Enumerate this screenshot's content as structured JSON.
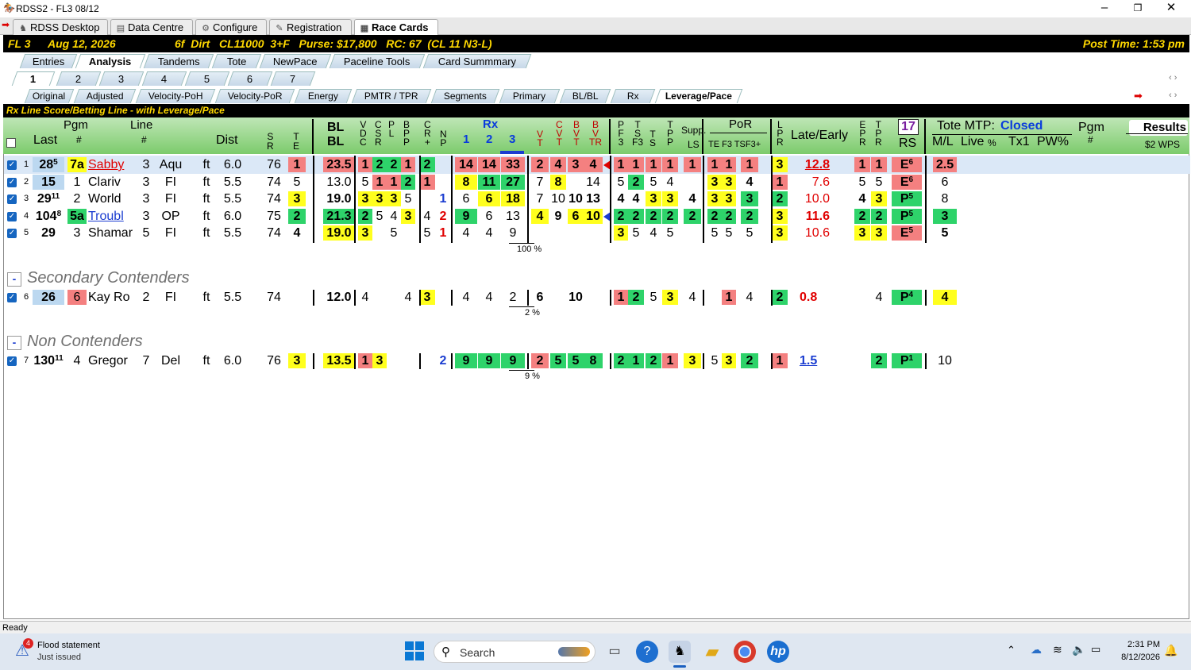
{
  "window": {
    "title": "RDSS2 - FL3  08/12"
  },
  "main_tabs": [
    {
      "label": "RDSS Desktop",
      "icon": "horse-icon"
    },
    {
      "label": "Data Centre",
      "icon": "database-icon"
    },
    {
      "label": "Configure",
      "icon": "gear-icon"
    },
    {
      "label": "Registration",
      "icon": "registration-icon"
    },
    {
      "label": "Race Cards",
      "icon": "document-icon"
    }
  ],
  "race_header": {
    "track_race": "FL  3",
    "date": "Aug 12, 2026",
    "conditions": "6f  Dirt   CL11000  3+F   Purse: $17,800   RC: 67  (CL 11 N3-L)",
    "post_time": "Post Time: 1:53 pm"
  },
  "view_tabs": [
    "Entries",
    "Analysis",
    "Tandems",
    "Tote",
    "NewPace",
    "Paceline Tools",
    "Card Summmary"
  ],
  "race_tabs": [
    "1",
    "2",
    "3",
    "4",
    "5",
    "6",
    "7"
  ],
  "analysis_tabs": [
    "Original",
    "Adjusted",
    "Velocity-PoH",
    "Velocity-PoR",
    "Energy",
    "PMTR / TPR",
    "Segments",
    "Primary",
    "BL/BL",
    "Rx",
    "Leverage/Pace"
  ],
  "rx_line_title": "Rx Line Score/Betting Line - with Leverage/Pace",
  "columns": {
    "last": "Last",
    "pgm": "Pgm",
    "pgm_hash": "#",
    "line": "Line",
    "line_hash": "#",
    "dist": "Dist",
    "sr": "S\nR",
    "te": "T\nE",
    "bl_top": "BL",
    "bl_bot": "BL",
    "vdc": "V\nD\nC",
    "csr": "C\nS\nR",
    "pl": "P\nL",
    "bpp": "B\nP\nP",
    "cr": "C\nR\n+",
    "np": "N\nP",
    "rx": "Rx",
    "rx1": "1",
    "rx2": "2",
    "rx3": "3",
    "vt": "V\nT",
    "cvt": "C\nV\nT",
    "bvt": "B\nV\nT",
    "bvtr": "B\nV\nTR",
    "pf3": "P\nF\n3",
    "stf3": "T\nS\nF3",
    "ts": "T\nS",
    "tpp": "T\nP\nP",
    "supp": "Supp.",
    "supp_ls": "LS",
    "por": "PoR",
    "por_sub": "TE F3 TSF3+",
    "lpr": "L\nP\nR",
    "late_early": "Late/Early",
    "epr": "E\nP\nR",
    "tpr": "T\nP\nR",
    "rs_num": "17",
    "rs": "RS",
    "tote_mtp": "Tote MTP:",
    "tote_status": "Closed",
    "ml": "M/L",
    "live": "Live",
    "pct": "%",
    "tx1": "Tx1",
    "pw": "PW%",
    "pgm2": "Pgm",
    "results": "Results",
    "wps": "$2 WPS"
  },
  "rows": [
    {
      "n": "1",
      "last": "28",
      "last_sup": "5",
      "pgm": "7a",
      "name": "Sabby",
      "line": "3",
      "trk": "Aqu",
      "surf": "ft",
      "dist": "6.0",
      "sr": "76",
      "te": "1",
      "bl": "23.5",
      "vdc": "1",
      "csr": "2",
      "pl": "2",
      "bpp": "1",
      "cr": "2",
      "np": "",
      "rx1": "14",
      "rx2": "14",
      "rx3": "33",
      "vt": "2",
      "cvt": "4",
      "bvt": "3",
      "bvtr": "4",
      "pf3": "1",
      "stf3": "1",
      "ts": "1",
      "tpp": "1",
      "ls": "1",
      "te2": "1",
      "f3": "1",
      "tsf3": "1",
      "lpr": "3",
      "le": "12.8",
      "epr": "1",
      "tpr": "1",
      "rs": "E",
      "rs_sup": "6",
      "ml": "2.5"
    },
    {
      "n": "2",
      "last": "15",
      "last_sup": "",
      "pgm": "1",
      "name": "Clariv",
      "line": "3",
      "trk": "FI",
      "surf": "ft",
      "dist": "5.5",
      "sr": "74",
      "te": "5",
      "bl": "13.0",
      "vdc": "5",
      "csr": "1",
      "pl": "1",
      "bpp": "2",
      "cr": "1",
      "np": "",
      "rx1": "8",
      "rx2": "11",
      "rx3": "27",
      "vt": "7",
      "cvt": "8",
      "bvt": "",
      "bvtr": "14",
      "pf3": "5",
      "stf3": "2",
      "ts": "5",
      "tpp": "4",
      "ls": "",
      "te2": "3",
      "f3": "3",
      "tsf3": "4",
      "lpr": "1",
      "le": "7.6",
      "epr": "5",
      "tpr": "5",
      "rs": "E",
      "rs_sup": "6",
      "ml": "6"
    },
    {
      "n": "3",
      "last": "29",
      "last_sup": "11",
      "pgm": "2",
      "name": "World",
      "line": "3",
      "trk": "FI",
      "surf": "ft",
      "dist": "5.5",
      "sr": "74",
      "te": "3",
      "bl": "19.0",
      "vdc": "3",
      "csr": "3",
      "pl": "3",
      "bpp": "5",
      "cr": "",
      "np": "1",
      "rx1": "6",
      "rx2": "6",
      "rx3": "18",
      "vt": "7",
      "cvt": "10",
      "bvt": "10",
      "bvtr": "13",
      "pf3": "4",
      "stf3": "4",
      "ts": "3",
      "tpp": "3",
      "ls": "4",
      "te2": "3",
      "f3": "3",
      "tsf3": "3",
      "lpr": "2",
      "le": "10.0",
      "epr": "4",
      "tpr": "3",
      "rs": "P",
      "rs_sup": "5",
      "ml": "8"
    },
    {
      "n": "4",
      "last": "104",
      "last_sup": "8",
      "pgm": "5a",
      "name": "Troubl",
      "line": "3",
      "trk": "OP",
      "surf": "ft",
      "dist": "6.0",
      "sr": "75",
      "te": "2",
      "bl": "21.3",
      "vdc": "2",
      "csr": "5",
      "pl": "4",
      "bpp": "3",
      "cr": "4",
      "np": "2",
      "rx1": "9",
      "rx2": "6",
      "rx3": "13",
      "vt": "4",
      "cvt": "9",
      "bvt": "6",
      "bvtr": "10",
      "pf3": "2",
      "stf3": "2",
      "ts": "2",
      "tpp": "2",
      "ls": "2",
      "te2": "2",
      "f3": "2",
      "tsf3": "2",
      "lpr": "3",
      "le": "11.6",
      "epr": "2",
      "tpr": "2",
      "rs": "P",
      "rs_sup": "5",
      "ml": "3"
    },
    {
      "n": "5",
      "last": "29",
      "last_sup": "",
      "pgm": "3",
      "name": "Shamar",
      "line": "5",
      "trk": "FI",
      "surf": "ft",
      "dist": "5.5",
      "sr": "74",
      "te": "4",
      "bl": "19.0",
      "vdc": "3",
      "csr": "",
      "pl": "5",
      "bpp": "",
      "cr": "5",
      "np": "1",
      "rx1": "4",
      "rx2": "4",
      "rx3": "9",
      "vt": "",
      "cvt": "",
      "bvt": "",
      "bvtr": "",
      "pf3": "3",
      "stf3": "5",
      "ts": "4",
      "tpp": "5",
      "ls": "",
      "te2": "5",
      "f3": "5",
      "tsf3": "5",
      "lpr": "3",
      "le": "10.6",
      "epr": "3",
      "tpr": "3",
      "rs": "E",
      "rs_sup": "5",
      "ml": "5"
    }
  ],
  "primary_pct": "100 %",
  "secondary_title": "Secondary Contenders",
  "secondary_row": {
    "n": "6",
    "last": "26",
    "pgm": "6",
    "name": "Kay Ro",
    "line": "2",
    "trk": "FI",
    "surf": "ft",
    "dist": "5.5",
    "sr": "74",
    "bl": "12.0",
    "vdc": "4",
    "bpp": "4",
    "cr": "3",
    "rx1": "4",
    "rx2": "4",
    "rx3": "2",
    "vt": "6",
    "bvt": "10",
    "pf3": "1",
    "stf3": "2",
    "ts": "5",
    "tpp": "3",
    "ls": "4",
    "f3": "1",
    "tsf3": "4",
    "lpr": "2",
    "le": "0.8",
    "tpr": "4",
    "rs": "P",
    "rs_sup": "4",
    "ml": "4",
    "pct": "2 %"
  },
  "non_title": "Non Contenders",
  "non_row": {
    "n": "7",
    "last": "130",
    "last_sup": "11",
    "pgm": "4",
    "name": "Gregor",
    "line": "7",
    "trk": "Del",
    "surf": "ft",
    "dist": "6.0",
    "sr": "76",
    "te": "3",
    "bl": "13.5",
    "vdc": "1",
    "csr": "3",
    "np": "2",
    "rx1": "9",
    "rx2": "9",
    "rx3": "9",
    "vt": "2",
    "cvt": "5",
    "bvt": "5",
    "bvtr": "8",
    "pf3": "2",
    "stf3": "1",
    "ts": "2",
    "tpp": "1",
    "ls": "3",
    "te2": "5",
    "f3": "3",
    "tsf3": "2",
    "lpr": "1",
    "le": "1.5",
    "tpr": "2",
    "rs": "P",
    "rs_sup": "1",
    "ml": "10",
    "pct": "9 %"
  },
  "section_toggle": "-",
  "status": "Ready",
  "taskbar": {
    "notif_title": "Flood statement",
    "notif_sub": "Just issued",
    "notif_badge": "4",
    "search": "Search",
    "time": "2:31 PM",
    "date": "8/12/2026"
  },
  "window_controls": [
    "–",
    "❐",
    "✕"
  ],
  "scroll_arrows": "‹ ›",
  "colors": {
    "yellow": "#ffff1e",
    "green": "#2ed36a",
    "red": "#f48080",
    "header_green": "#7ccb6c",
    "accent_blue": "#1a3cd0"
  }
}
